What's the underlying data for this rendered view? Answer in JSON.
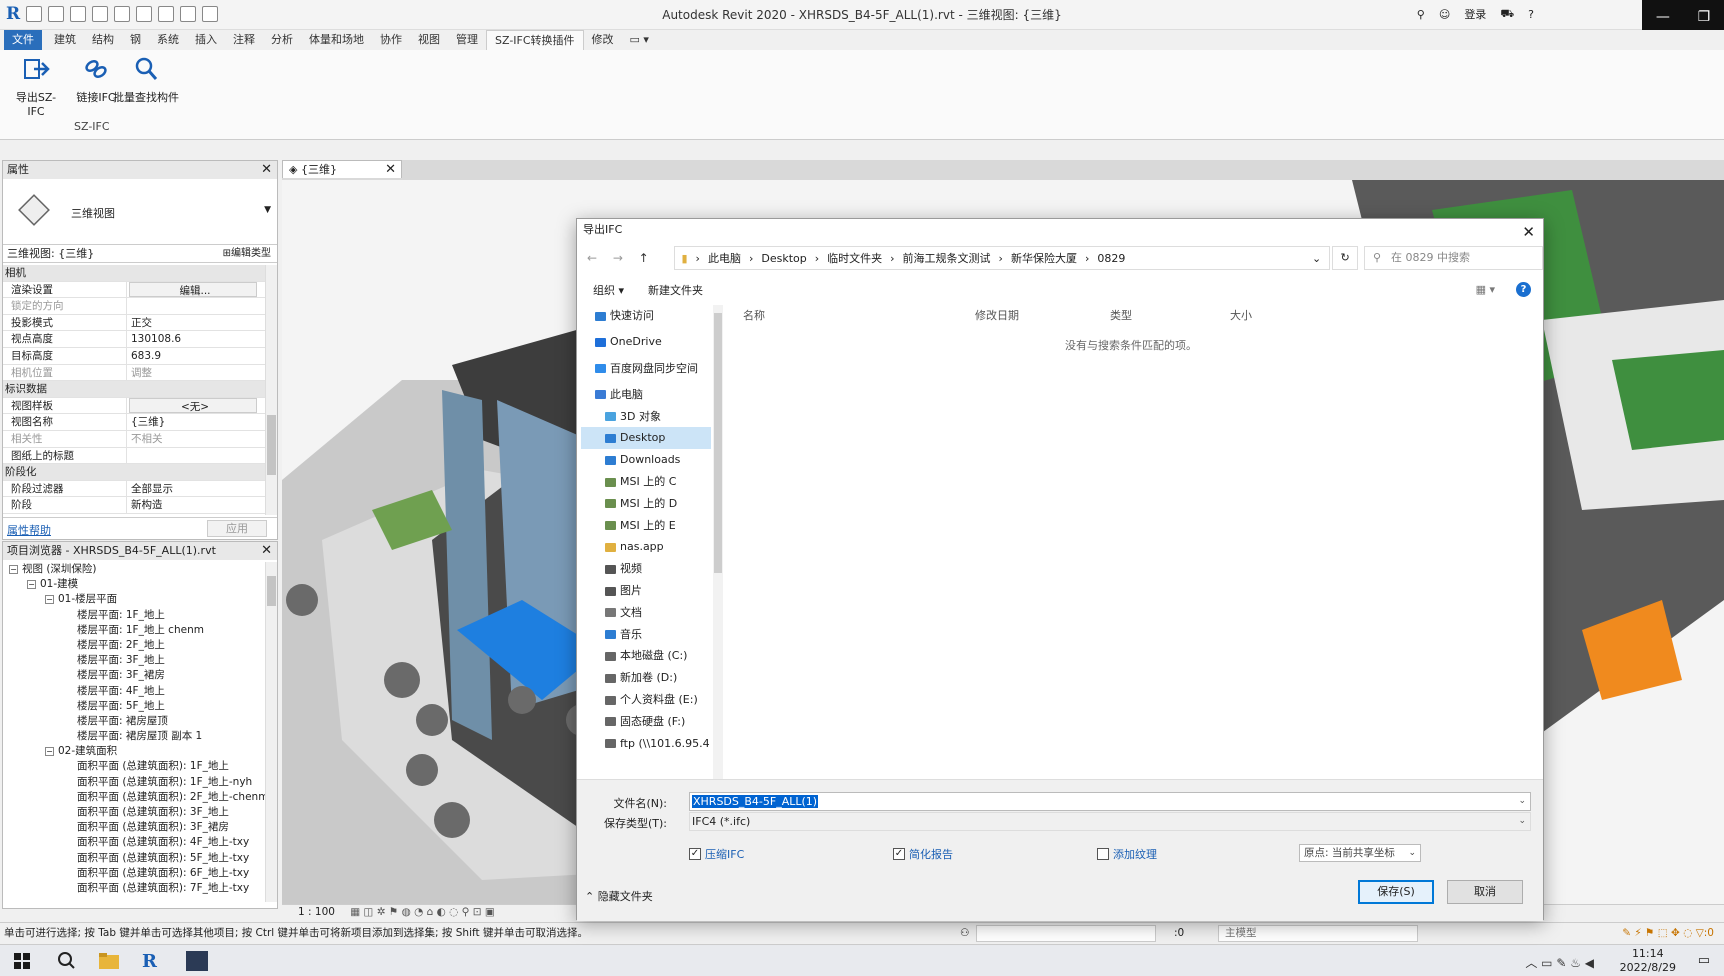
{
  "titlebar": {
    "title": "Autodesk Revit 2020 - XHRSDS_B4-5F_ALL(1).rvt - 三维视图: {三维}",
    "login": "登录"
  },
  "ribbon": {
    "tabs": [
      "文件",
      "建筑",
      "结构",
      "钢",
      "系统",
      "插入",
      "注释",
      "分析",
      "体量和场地",
      "协作",
      "视图",
      "管理",
      "SZ-IFC转换插件",
      "修改"
    ],
    "active_tab": "SZ-IFC转换插件",
    "buttons": [
      {
        "label": "导出SZ-IFC",
        "icon": "export-arrow-icon"
      },
      {
        "label": "链接IFC",
        "icon": "link-chain-icon"
      },
      {
        "label": "批量查找构件",
        "icon": "magnifier-icon"
      }
    ],
    "group_label": "SZ-IFC"
  },
  "properties": {
    "header": "属性",
    "type_name": "三维视图",
    "selector": "三维视图: {三维}",
    "edit_type": "编辑类型",
    "rows": [
      {
        "cat": true,
        "k": "相机"
      },
      {
        "k": "渲染设置",
        "v": "编辑...",
        "button": true
      },
      {
        "k": "锁定的方向",
        "v": "",
        "dim": true
      },
      {
        "k": "投影模式",
        "v": "正交"
      },
      {
        "k": "视点高度",
        "v": "130108.6"
      },
      {
        "k": "目标高度",
        "v": "683.9"
      },
      {
        "k": "相机位置",
        "v": "调整",
        "dim": true
      },
      {
        "cat": true,
        "k": "标识数据"
      },
      {
        "k": "视图样板",
        "v": "<无>",
        "button": true
      },
      {
        "k": "视图名称",
        "v": "{三维}"
      },
      {
        "k": "相关性",
        "v": "不相关",
        "dim": true
      },
      {
        "k": "图纸上的标题",
        "v": ""
      },
      {
        "cat": true,
        "k": "阶段化"
      },
      {
        "k": "阶段过滤器",
        "v": "全部显示"
      },
      {
        "k": "阶段",
        "v": "新构造"
      }
    ],
    "help_link": "属性帮助",
    "apply": "应用"
  },
  "browser": {
    "header": "项目浏览器 - XHRSDS_B4-5F_ALL(1).rvt",
    "items": [
      {
        "indent": 0,
        "toggle": "−",
        "label": "视图 (深圳保险)"
      },
      {
        "indent": 1,
        "toggle": "−",
        "label": "01-建模"
      },
      {
        "indent": 2,
        "toggle": "−",
        "label": "01-楼层平面"
      },
      {
        "indent": 3,
        "label": "楼层平面: 1F_地上"
      },
      {
        "indent": 3,
        "label": "楼层平面: 1F_地上 chenm"
      },
      {
        "indent": 3,
        "label": "楼层平面: 2F_地上"
      },
      {
        "indent": 3,
        "label": "楼层平面: 3F_地上"
      },
      {
        "indent": 3,
        "label": "楼层平面: 3F_裙房"
      },
      {
        "indent": 3,
        "label": "楼层平面: 4F_地上"
      },
      {
        "indent": 3,
        "label": "楼层平面: 5F_地上"
      },
      {
        "indent": 3,
        "label": "楼层平面: 裙房屋顶"
      },
      {
        "indent": 3,
        "label": "楼层平面: 裙房屋顶 副本 1"
      },
      {
        "indent": 2,
        "toggle": "−",
        "label": "02-建筑面积"
      },
      {
        "indent": 3,
        "label": "面积平面 (总建筑面积): 1F_地上"
      },
      {
        "indent": 3,
        "label": "面积平面 (总建筑面积): 1F_地上-nyh"
      },
      {
        "indent": 3,
        "label": "面积平面 (总建筑面积): 2F_地上-chenm"
      },
      {
        "indent": 3,
        "label": "面积平面 (总建筑面积): 3F_地上"
      },
      {
        "indent": 3,
        "label": "面积平面 (总建筑面积): 3F_裙房"
      },
      {
        "indent": 3,
        "label": "面积平面 (总建筑面积): 4F_地上-txy"
      },
      {
        "indent": 3,
        "label": "面积平面 (总建筑面积): 5F_地上-txy"
      },
      {
        "indent": 3,
        "label": "面积平面 (总建筑面积): 6F_地上-txy"
      },
      {
        "indent": 3,
        "label": "面积平面 (总建筑面积): 7F_地上-txy"
      }
    ]
  },
  "viewport": {
    "tab_label": "{三维}",
    "scale": "1 : 100"
  },
  "dialog": {
    "title": "导出IFC",
    "breadcrumb": [
      "此电脑",
      "Desktop",
      "临时文件夹",
      "前海工规条文测试",
      "新华保险大厦",
      "0829"
    ],
    "search_placeholder": "在 0829 中搜索",
    "organize": "组织 ▾",
    "new_folder": "新建文件夹",
    "nav": [
      {
        "label": "快速访问",
        "icon": "pin-icon",
        "color": "#2d7dd2",
        "gap": true
      },
      {
        "label": "OneDrive",
        "icon": "cloud-icon",
        "color": "#1e6fd9",
        "gap": true
      },
      {
        "label": "百度网盘同步空间",
        "icon": "baidu-icon",
        "color": "#2f8cea",
        "gap": true
      },
      {
        "label": "此电脑",
        "icon": "pc-icon",
        "color": "#3a7bd5"
      },
      {
        "label": "3D 对象",
        "icon": "cube-icon",
        "color": "#4aa3df",
        "sub": true
      },
      {
        "label": "Desktop",
        "icon": "desktop-icon",
        "color": "#2d7dd2",
        "sub": true,
        "selected": true
      },
      {
        "label": "Downloads",
        "icon": "download-icon",
        "color": "#2d7dd2",
        "sub": true
      },
      {
        "label": "MSI 上的 C",
        "icon": "network-drive-icon",
        "color": "#6a8f4e",
        "sub": true
      },
      {
        "label": "MSI 上的 D",
        "icon": "network-drive-icon",
        "color": "#6a8f4e",
        "sub": true
      },
      {
        "label": "MSI 上的 E",
        "icon": "network-drive-icon",
        "color": "#6a8f4e",
        "sub": true
      },
      {
        "label": "nas.app",
        "icon": "folder-icon",
        "color": "#e0b040",
        "sub": true
      },
      {
        "label": "视频",
        "icon": "video-icon",
        "color": "#555",
        "sub": true
      },
      {
        "label": "图片",
        "icon": "picture-icon",
        "color": "#555",
        "sub": true
      },
      {
        "label": "文档",
        "icon": "document-icon",
        "color": "#777",
        "sub": true
      },
      {
        "label": "音乐",
        "icon": "music-icon",
        "color": "#2d7dd2",
        "sub": true
      },
      {
        "label": "本地磁盘 (C:)",
        "icon": "drive-icon",
        "color": "#666",
        "sub": true
      },
      {
        "label": "新加卷 (D:)",
        "icon": "drive-icon",
        "color": "#666",
        "sub": true
      },
      {
        "label": "个人资料盘 (E:)",
        "icon": "drive-icon",
        "color": "#666",
        "sub": true
      },
      {
        "label": "固态硬盘 (F:)",
        "icon": "drive-icon",
        "color": "#666",
        "sub": true
      },
      {
        "label": "ftp (\\\\101.6.95.4",
        "icon": "network-drive-icon",
        "color": "#666",
        "sub": true
      }
    ],
    "columns": [
      "名称",
      "修改日期",
      "类型",
      "大小"
    ],
    "empty_text": "没有与搜索条件匹配的项。",
    "filename_label": "文件名(N):",
    "filename_value": "XHRSDS_B4-5F_ALL(1)",
    "filetype_label": "保存类型(T):",
    "filetype_value": "IFC4 (*.ifc)",
    "checks": [
      {
        "label": "压缩IFC",
        "checked": true
      },
      {
        "label": "简化报告",
        "checked": true
      },
      {
        "label": "添加纹理",
        "checked": false
      }
    ],
    "origin": "原点: 当前共享坐标",
    "hide_folders": "隐藏文件夹",
    "save": "保存(S)",
    "cancel": "取消"
  },
  "statusbar": {
    "text": "单击可进行选择; 按 Tab 键并单击可选择其他项目; 按 Ctrl 键并单击可将新项目添加到选择集; 按 Shift 键并单击可取消选择。",
    "zero": ":0",
    "model": "主模型"
  },
  "taskbar": {
    "time": "11:14",
    "date": "2022/8/29"
  }
}
